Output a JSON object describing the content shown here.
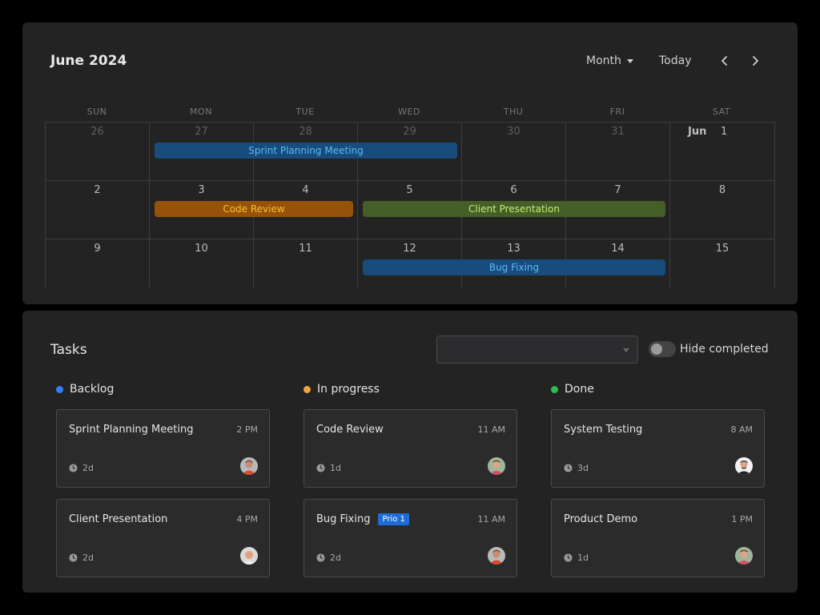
{
  "calendar": {
    "title": "June 2024",
    "view": "Month",
    "today_label": "Today",
    "prev_icon": "chevron-left-icon",
    "next_icon": "chevron-right-icon",
    "weekdays": [
      "SUN",
      "MON",
      "TUE",
      "WED",
      "THU",
      "FRI",
      "SAT"
    ],
    "month_tag": "Jun",
    "weeks": [
      [
        "26",
        "27",
        "28",
        "29",
        "30",
        "31",
        "1"
      ],
      [
        "2",
        "3",
        "4",
        "5",
        "6",
        "7",
        "8"
      ],
      [
        "9",
        "10",
        "11",
        "12",
        "13",
        "14",
        "15"
      ]
    ],
    "events": [
      {
        "title": "Sprint Planning Meeting",
        "bg": "#174c7d",
        "fg": "#5bbcf5"
      },
      {
        "title": "Code Review",
        "bg": "#965209",
        "fg": "#f5c22c"
      },
      {
        "title": "Client Presentation",
        "bg": "#465f29",
        "fg": "#c2ee74"
      },
      {
        "title": "Bug Fixing",
        "bg": "#174c7d",
        "fg": "#5bbcf5"
      }
    ]
  },
  "tasks": {
    "title": "Tasks",
    "filter_value": "",
    "hide_completed_label": "Hide completed",
    "hide_completed": false,
    "columns": [
      {
        "name": "Backlog",
        "color": "#2d7fff",
        "cards": [
          {
            "title": "Sprint Planning Meeting",
            "time": "2 PM",
            "duration": "2d",
            "avatar": "avatar-icon"
          },
          {
            "title": "Client Presentation",
            "time": "4 PM",
            "duration": "2d",
            "avatar": "avatar-icon"
          }
        ]
      },
      {
        "name": "In progress",
        "color": "#f4a53a",
        "cards": [
          {
            "title": "Code Review",
            "time": "11 AM",
            "duration": "1d",
            "avatar": "avatar-icon"
          },
          {
            "title": "Bug Fixing",
            "badge": "Prio 1",
            "time": "11 AM",
            "duration": "2d",
            "avatar": "avatar-icon"
          }
        ]
      },
      {
        "name": "Done",
        "color": "#2bbf4e",
        "cards": [
          {
            "title": "System Testing",
            "time": "8 AM",
            "duration": "3d",
            "avatar": "avatar-icon"
          },
          {
            "title": "Product Demo",
            "time": "1 PM",
            "duration": "1d",
            "avatar": "avatar-icon"
          }
        ]
      }
    ]
  }
}
